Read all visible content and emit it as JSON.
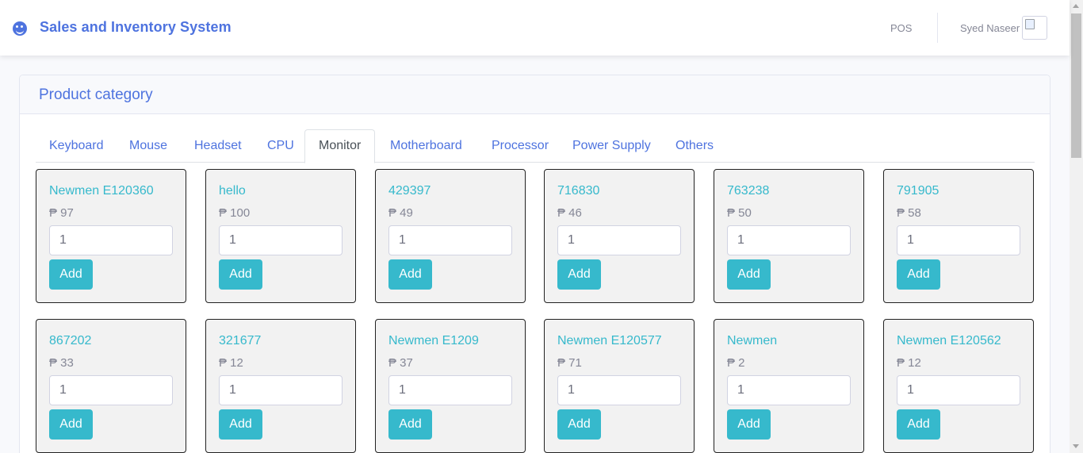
{
  "header": {
    "brand": "Sales and Inventory System",
    "brand_icon": "grin-icon",
    "pos_link": "POS",
    "user_name": "Syed Naseer"
  },
  "card": {
    "title": "Product category"
  },
  "tabs": [
    {
      "label": "Keyboard"
    },
    {
      "label": "Mouse"
    },
    {
      "label": "Headset"
    },
    {
      "label": "CPU"
    },
    {
      "label": "Monitor",
      "active": true
    },
    {
      "label": "Motherboard"
    },
    {
      "label": "Processor"
    },
    {
      "label": "Power Supply"
    },
    {
      "label": "Others"
    }
  ],
  "add_label": "Add",
  "products": [
    {
      "name": "Newmen E120360",
      "price": "₱ 97",
      "qty": "1"
    },
    {
      "name": "hello",
      "price": "₱ 100",
      "qty": "1"
    },
    {
      "name": "429397",
      "price": "₱ 49",
      "qty": "1"
    },
    {
      "name": "716830",
      "price": "₱ 46",
      "qty": "1"
    },
    {
      "name": "763238",
      "price": "₱ 50",
      "qty": "1"
    },
    {
      "name": "791905",
      "price": "₱ 58",
      "qty": "1"
    },
    {
      "name": "867202",
      "price": "₱ 33",
      "qty": "1"
    },
    {
      "name": "321677",
      "price": "₱ 12",
      "qty": "1"
    },
    {
      "name": "Newmen E1209",
      "price": "₱ 37",
      "qty": "1"
    },
    {
      "name": "Newmen E120577",
      "price": "₱ 71",
      "qty": "1"
    },
    {
      "name": "Newmen",
      "price": "₱ 2",
      "qty": "1"
    },
    {
      "name": "Newmen E120562",
      "price": "₱ 12",
      "qty": "1"
    }
  ],
  "colors": {
    "primary": "#4e73df",
    "info": "#36b9cc",
    "muted": "#858796"
  }
}
